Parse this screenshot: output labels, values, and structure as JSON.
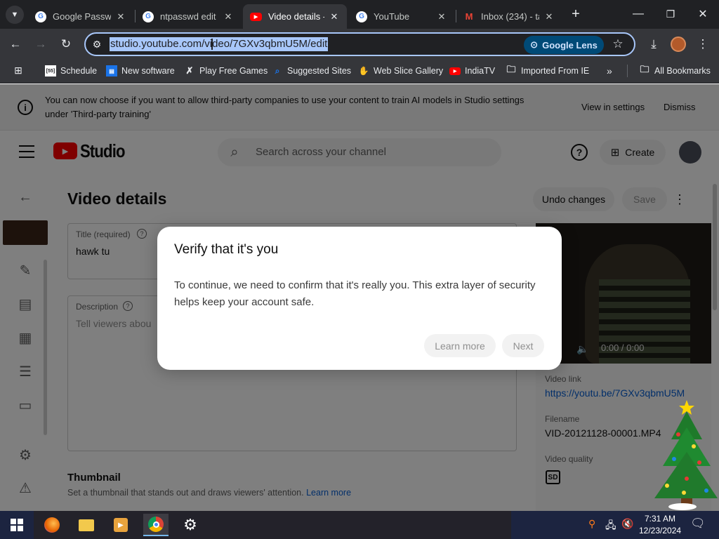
{
  "browser": {
    "tabs": [
      {
        "label": "Google Passw",
        "favicon": "google-icon",
        "active": false
      },
      {
        "label": "ntpasswd edit",
        "favicon": "google-icon",
        "active": false
      },
      {
        "label": "Video details -",
        "favicon": "youtube-studio-icon",
        "active": true
      },
      {
        "label": "YouTube",
        "favicon": "google-icon",
        "active": false
      },
      {
        "label": "Inbox (234) - ta",
        "favicon": "gmail-icon",
        "active": false
      }
    ],
    "url": "studio.youtube.com/video/7GXv3qbmU5M/edit",
    "lens_label": "Google Lens",
    "bookmarks": [
      {
        "label": "Schedule",
        "icon": "schedule-icon"
      },
      {
        "label": "New software",
        "icon": "new-software-icon"
      },
      {
        "label": "Play Free Games",
        "icon": "games-icon"
      },
      {
        "label": "Suggested Sites",
        "icon": "suggested-sites-icon"
      },
      {
        "label": "Web Slice Gallery",
        "icon": "web-slice-icon"
      },
      {
        "label": "IndiaTV",
        "icon": "youtube-icon"
      },
      {
        "label": "Imported From IE",
        "icon": "folder-icon"
      }
    ],
    "more_bookmarks": "»",
    "all_bookmarks": "All Bookmarks"
  },
  "studio": {
    "banner_text": "You can now choose if you want to allow third-party companies to use your content to train AI models in Studio settings under 'Third-party training'",
    "banner_view": "View in settings",
    "banner_dismiss": "Dismiss",
    "logo_text": "Studio",
    "search_placeholder": "Search across your channel",
    "create_label": "Create",
    "page_title": "Video details",
    "undo_label": "Undo changes",
    "save_label": "Save",
    "title_label": "Title (required)",
    "title_value": "hawk tu",
    "description_label": "Description",
    "description_placeholder": "Tell viewers abou",
    "thumbnail_heading": "Thumbnail",
    "thumbnail_text": "Set a thumbnail that stands out and draws viewers' attention.",
    "thumbnail_learn_more": "Learn more",
    "player_time": "0:00 / 0:00",
    "video_link_label": "Video link",
    "video_link": "https://youtu.be/7GXv3qbmU5M",
    "filename_label": "Filename",
    "filename": "VID-20121128-00001.MP4",
    "video_quality_label": "Video quality",
    "quality_badge": "SD"
  },
  "dialog": {
    "title": "Verify that it's you",
    "body": "To continue, we need to confirm that it's really you. This extra layer of security helps keep your account safe.",
    "learn_more": "Learn more",
    "next": "Next"
  },
  "taskbar": {
    "time": "7:31 AM",
    "date": "12/23/2024"
  },
  "colors": {
    "accent": "#065fd4",
    "youtube_red": "#ff0000",
    "chrome_dark": "#202124"
  }
}
